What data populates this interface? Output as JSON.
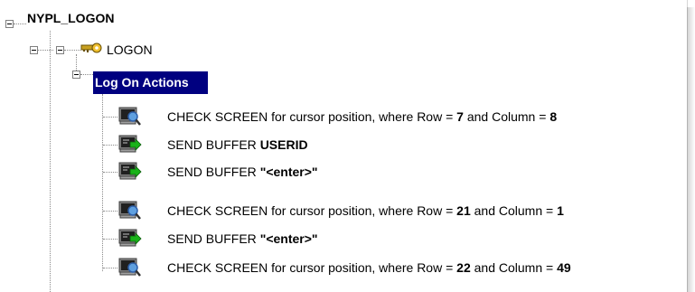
{
  "tree": {
    "root_label": "NYPL_LOGON",
    "logon_label": "LOGON",
    "actions_label": "Log On Actions",
    "actions": [
      {
        "type": "check",
        "prefix": "CHECK SCREEN for cursor position, where Row = ",
        "row": "7",
        "mid": " and Column = ",
        "col": "8"
      },
      {
        "type": "send",
        "prefix": "SEND BUFFER ",
        "value": "USERID"
      },
      {
        "type": "send",
        "prefix": "SEND BUFFER ",
        "value": "\"<enter>\""
      },
      {
        "type": "check",
        "prefix": "CHECK SCREEN for cursor position, where Row = ",
        "row": "21",
        "mid": " and Column = ",
        "col": "1"
      },
      {
        "type": "send",
        "prefix": "SEND BUFFER ",
        "value": "\"<enter>\""
      },
      {
        "type": "check",
        "prefix": "CHECK SCREEN for cursor position, where Row = ",
        "row": "22",
        "mid": " and Column = ",
        "col": "49"
      }
    ]
  },
  "colors": {
    "selection_bg": "#000080",
    "send_icon_arrow": "#19b319",
    "check_icon_lens": "#2f5fa8"
  }
}
